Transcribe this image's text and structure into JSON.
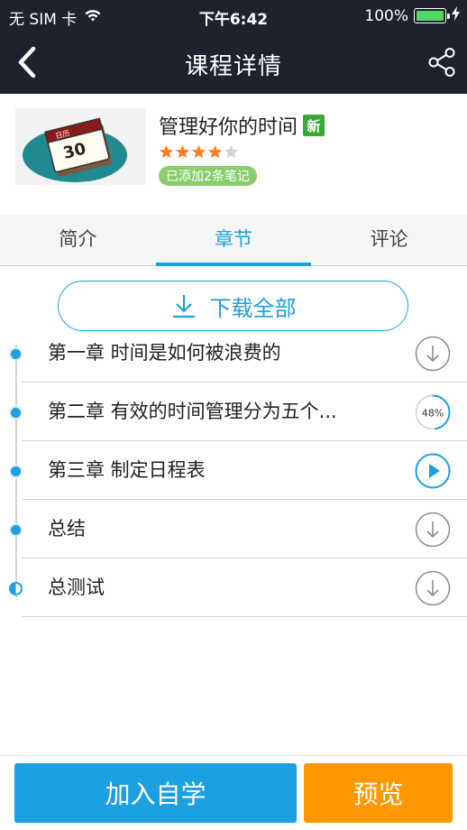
{
  "status_bar": {
    "carrier": "无 SIM 卡",
    "time": "下午6:42",
    "battery": "100%",
    "battery_level": 1.0,
    "wifi_icon": "wifi-icon",
    "charging_icon": "bolt-icon"
  },
  "nav": {
    "title": "课程详情",
    "back_icon": "chevron-left-icon",
    "share_icon": "share-icon"
  },
  "course": {
    "title": "管理好你的时间",
    "new_badge": "新",
    "rating": 4,
    "rating_max": 5,
    "notes_badge": "已添加2条笔记",
    "cover_text": "30",
    "cover_header": "日历"
  },
  "tabs": [
    {
      "label": "简介",
      "active": false
    },
    {
      "label": "章节",
      "active": true
    },
    {
      "label": "评论",
      "active": false
    }
  ],
  "download_all": {
    "label": "下载全部",
    "icon": "download-icon"
  },
  "chapters": [
    {
      "title": "第一章 时间是如何被浪费的",
      "action": "download",
      "progress": null,
      "dot": "full"
    },
    {
      "title": "第二章 有效的时间管理分为五个...",
      "action": "progress",
      "progress": "48%",
      "progress_value": 0.48,
      "dot": "full"
    },
    {
      "title": "第三章 制定日程表",
      "action": "play",
      "progress": null,
      "dot": "full"
    },
    {
      "title": "总结",
      "action": "download",
      "progress": null,
      "dot": "full"
    },
    {
      "title": "总测试",
      "action": "download",
      "progress": null,
      "dot": "half"
    }
  ],
  "bottom": {
    "join_label": "加入自学",
    "preview_label": "预览"
  },
  "colors": {
    "accent": "#1ba1e2",
    "header_bg": "#1d222d",
    "preview": "#ff9800",
    "new_badge": "#39a935",
    "star": "#ff7f1f",
    "notes_badge": "#8acd6e"
  }
}
